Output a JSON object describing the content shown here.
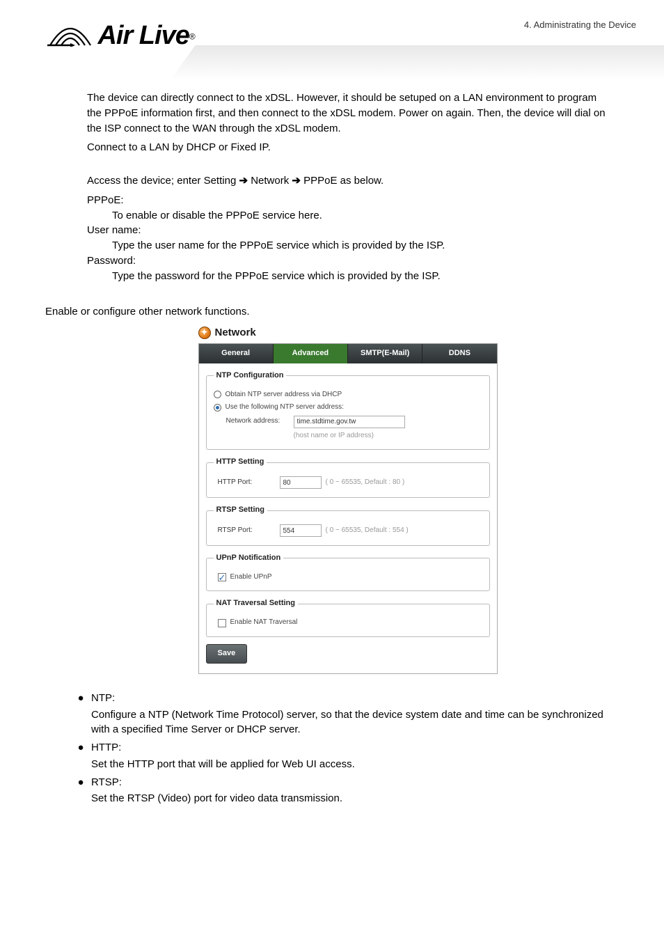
{
  "header": {
    "chapter": "4.   Administrating  the  Device",
    "logo_text": "Air Live",
    "logo_reg": "®"
  },
  "body": {
    "p1": "The device can directly connect to the xDSL. However, it should be setuped on a LAN environment to program the PPPoE information first, and then connect to the xDSL modem.    Power on again.    Then, the device will dial on the ISP connect to the WAN through the xDSL modem.",
    "p2": "Connect to a LAN by DHCP or Fixed IP.",
    "p3a": "Access the device; enter Setting ",
    "p3b": " Network ",
    "p3c": " PPPoE as below.",
    "pppoe_label": "PPPoE:",
    "pppoe_desc": "To enable or disable the PPPoE service here.",
    "user_label": "User name:",
    "user_desc": "Type the user name for the PPPoE service which is provided by the ISP.",
    "pw_label": "Password:",
    "pw_desc": "Type the password for the PPPoE service which is provided by the ISP.",
    "enable_intro": "Enable or configure other network functions."
  },
  "panel": {
    "title": "Network",
    "tabs": {
      "general": "General",
      "advanced": "Advanced",
      "smtp": "SMTP(E-Mail)",
      "ddns": "DDNS"
    },
    "ntp": {
      "legend": "NTP Configuration",
      "opt_dhcp": "Obtain NTP server address via DHCP",
      "opt_manual": "Use the following NTP server address:",
      "addr_label": "Network address:",
      "addr_value": "time.stdtime.gov.tw",
      "addr_hint": "(host name or IP address)"
    },
    "http": {
      "legend": "HTTP Setting",
      "label": "HTTP Port:",
      "value": "80",
      "hint": "( 0 ~ 65535, Default : 80 )"
    },
    "rtsp": {
      "legend": "RTSP Setting",
      "label": "RTSP Port:",
      "value": "554",
      "hint": "( 0 ~ 65535, Default : 554 )"
    },
    "upnp": {
      "legend": "UPnP Notification",
      "label": "Enable UPnP"
    },
    "nat": {
      "legend": "NAT Traversal Setting",
      "label": "Enable NAT Traversal"
    },
    "save": "Save"
  },
  "bullets": {
    "ntp_h": "NTP:",
    "ntp_b": "Configure a NTP (Network Time Protocol) server, so that the device system date and time can be synchronized with a specified Time Server or DHCP server.",
    "http_h": "HTTP:",
    "http_b": "Set the HTTP port that will be applied for Web UI access.",
    "rtsp_h": "RTSP:",
    "rtsp_b": "Set the RTSP (Video) port for video data transmission."
  }
}
